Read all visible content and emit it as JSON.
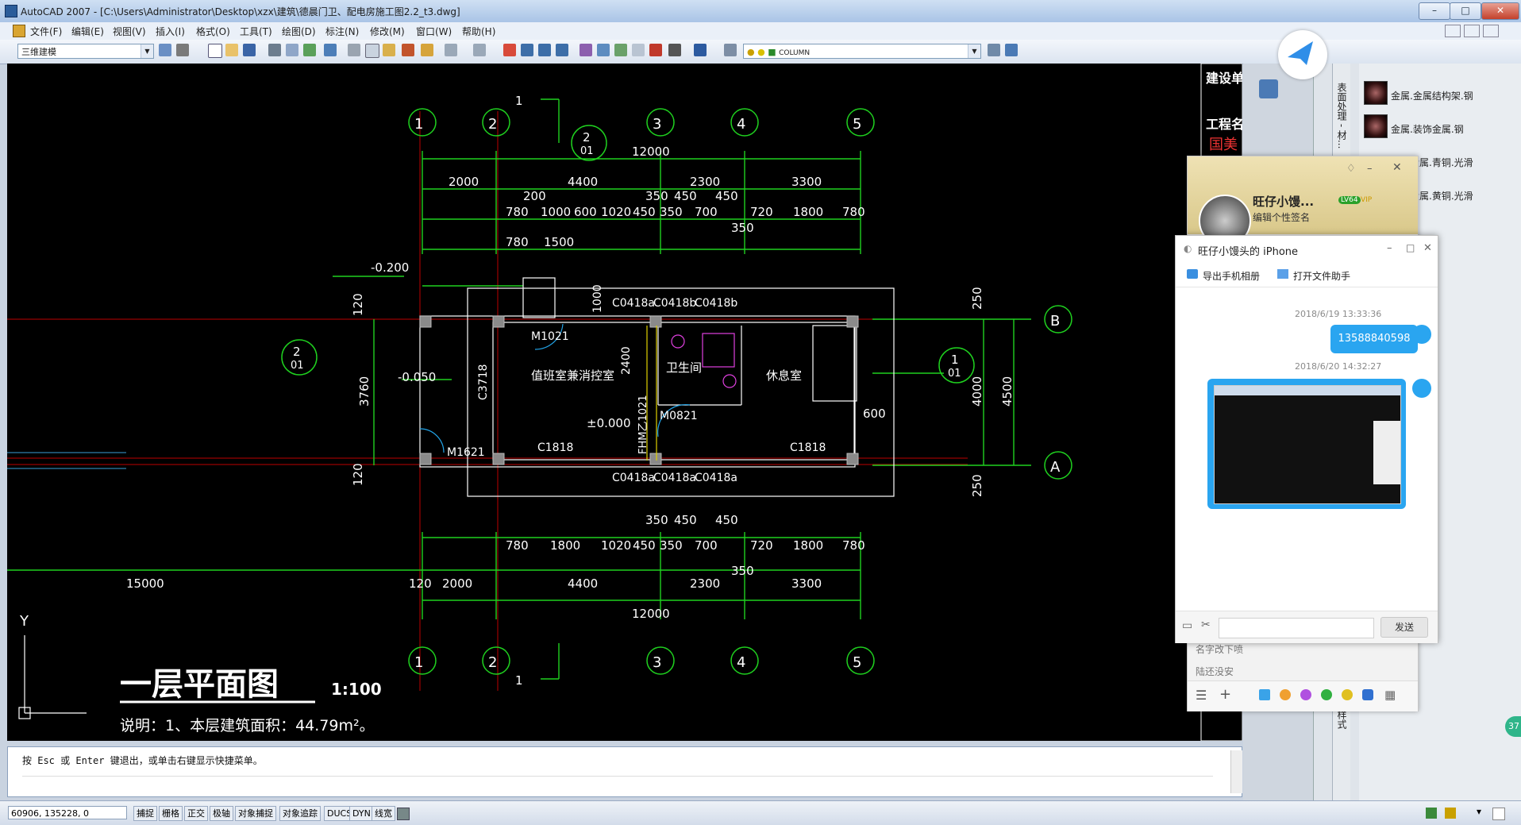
{
  "window": {
    "title": "AutoCAD 2007 - [C:\\Users\\Administrator\\Desktop\\xzx\\建筑\\德晨门卫、配电房施工图2.2_t3.dwg]",
    "min": "–",
    "max": "□",
    "close": "✕"
  },
  "menu": [
    "文件(F)",
    "编辑(E)",
    "视图(V)",
    "插入(I)",
    "格式(O)",
    "工具(T)",
    "绘图(D)",
    "标注(N)",
    "修改(M)",
    "窗口(W)",
    "帮助(H)"
  ],
  "toolbar": {
    "workspace": "三维建模",
    "layer": "COLUMN"
  },
  "drawing": {
    "axes_top": [
      "1",
      "2",
      "3",
      "4",
      "5"
    ],
    "axes_side": [
      "B",
      "A"
    ],
    "dims_top_total": "12000",
    "dims_top_row1": [
      "2000",
      "4400",
      "2300",
      "3300"
    ],
    "dims_top_row2": [
      "200",
      "350",
      "450",
      "450",
      "350"
    ],
    "dims_top_row3": [
      "780",
      "1000",
      "600",
      "1020",
      "450",
      "350",
      "700",
      "720",
      "1800",
      "780"
    ],
    "dims_top_row4": [
      "780",
      "1500"
    ],
    "dims_bottom_row1": [
      "780",
      "1800",
      "1020",
      "450",
      "350",
      "700",
      "720",
      "1800",
      "780"
    ],
    "dims_bottom_row0": [
      "350",
      "450",
      "450",
      "350"
    ],
    "dims_bottom_row2": [
      "15000",
      "120",
      "2000",
      "4400",
      "2300",
      "3300"
    ],
    "dims_bottom_total": "12000",
    "dims_left": [
      "120",
      "3760",
      "120"
    ],
    "dims_right": [
      "250",
      "4000",
      "4500",
      "250",
      "600"
    ],
    "elev1": "-0.200",
    "elev2": "-0.050",
    "elev3": "±0.000",
    "section_top": "1",
    "section_bottom": "1",
    "section_label_top": "2",
    "section_label_top_sub": "01",
    "section_label_left": "2",
    "section_label_left_sub": "01",
    "section_label_right": "1",
    "section_label_right_sub": "01",
    "rooms": {
      "control": "值班室兼消控室",
      "wc": "卫生间",
      "rest": "休息室"
    },
    "tags": {
      "c0418a_top": "C0418a",
      "c0418b_1": "C0418b",
      "c0418b_2": "C0418b",
      "m1021": "M1021",
      "c3718": "C3718",
      "m0821": "M0821",
      "fhm": "FHM乙1021",
      "c1818_l": "C1818",
      "c1818_r": "C1818",
      "m1621": "M1621",
      "c0418a_b1": "C0418a",
      "c0418a_b2": "C0418a",
      "c0418a_b3": "C0418a",
      "d1000": "1000",
      "d2400": "2400"
    },
    "plan_title": "一层平面图",
    "plan_scale": "1:100",
    "note": "说明：1、本层建筑面积：44.79m²。",
    "ucs_y": "Y",
    "title_block_1": "建设单",
    "title_block_2": "工程名",
    "title_block_3": "国美"
  },
  "palette": {
    "items": [
      "金属.金属结构架.钢",
      "金属.装饰金属.钢",
      "装饰金属.青铜.光滑",
      "装饰金属.黄铜.光滑"
    ],
    "tab1": "表面处理 - 材...",
    "tab2": "视觉样式"
  },
  "qq_main": {
    "name": "旺仔小馒...",
    "level": "LV64",
    "vip": "VIP",
    "signature": "编辑个性签名",
    "contact1": "名字改下喷",
    "contact2": "陆还没安"
  },
  "qq_chat": {
    "title": "旺仔小馒头的 iPhone",
    "tool1": "导出手机相册",
    "tool2": "打开文件助手",
    "ts1": "2018/6/19 13:33:36",
    "msg1": "13588840598",
    "ts2": "2018/6/20 14:32:27",
    "send": "发送"
  },
  "command": {
    "line1": "按 Esc 或 Enter 键退出，或单击右键显示快捷菜单。"
  },
  "status": {
    "coords": "60906, 135228, 0",
    "buttons": [
      "捕捉",
      "栅格",
      "正交",
      "极轴",
      "对象捕捉",
      "对象追踪",
      "DUCS",
      "DYN",
      "线宽"
    ]
  },
  "badge": "37"
}
